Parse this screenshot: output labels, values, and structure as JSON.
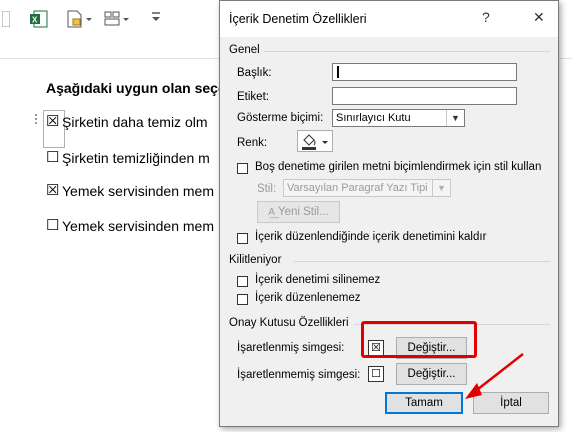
{
  "document": {
    "heading": "Aşağıdaki uygun olan seçe",
    "items": [
      {
        "glyph": "☒",
        "text": "Şirketin daha temiz olm"
      },
      {
        "glyph": "☐",
        "text": "Şirketin temizliğinden m"
      },
      {
        "glyph": "☒",
        "text": "Yemek servisinden mem"
      },
      {
        "glyph": "☐",
        "text": "Yemek servisinden mem"
      }
    ]
  },
  "dialog": {
    "title": "İçerik Denetim Özellikleri",
    "help_button": "?",
    "close_button": "✕",
    "general_section": "Genel",
    "title_label": "Başlık:",
    "tag_label": "Etiket:",
    "display_label": "Gösterme biçimi:",
    "display_value": "Sınırlayıcı Kutu",
    "color_label": "Renk:",
    "style_check_label": "Boş denetime girilen metni biçimlendirmek için stil kullan",
    "style_label": "Stil:",
    "style_value": "Varsayılan Paragraf Yazı Tipi",
    "new_style_button": "Yeni Stil...",
    "remove_check_label": "İçerik düzenlendiğinde içerik denetimini kaldır",
    "locking_section": "Kilitleniyor",
    "cannot_delete_label": "İçerik denetimi silinemez",
    "cannot_edit_label": "İçerik düzenlenemez",
    "checkbox_section": "Onay Kutusu Özellikleri",
    "checked_symbol_label": "İşaretlenmiş simgesi:",
    "checked_symbol": "☒",
    "unchecked_symbol_label": "İşaretlenmemiş simgesi:",
    "unchecked_symbol": "☐",
    "change_button_1": "Değiştir...",
    "change_button_2": "Değiştir...",
    "ok_button": "Tamam",
    "cancel_button": "İptal"
  },
  "colors": {
    "annotation_red": "#e00000",
    "accent_blue": "#0078d7",
    "excel_green": "#1d6f42"
  },
  "icons": [
    "excel-icon",
    "file-new-icon",
    "layout-icon",
    "dropdown-arrow-icon",
    "paint-bucket-icon",
    "red-arrow-icon"
  ]
}
